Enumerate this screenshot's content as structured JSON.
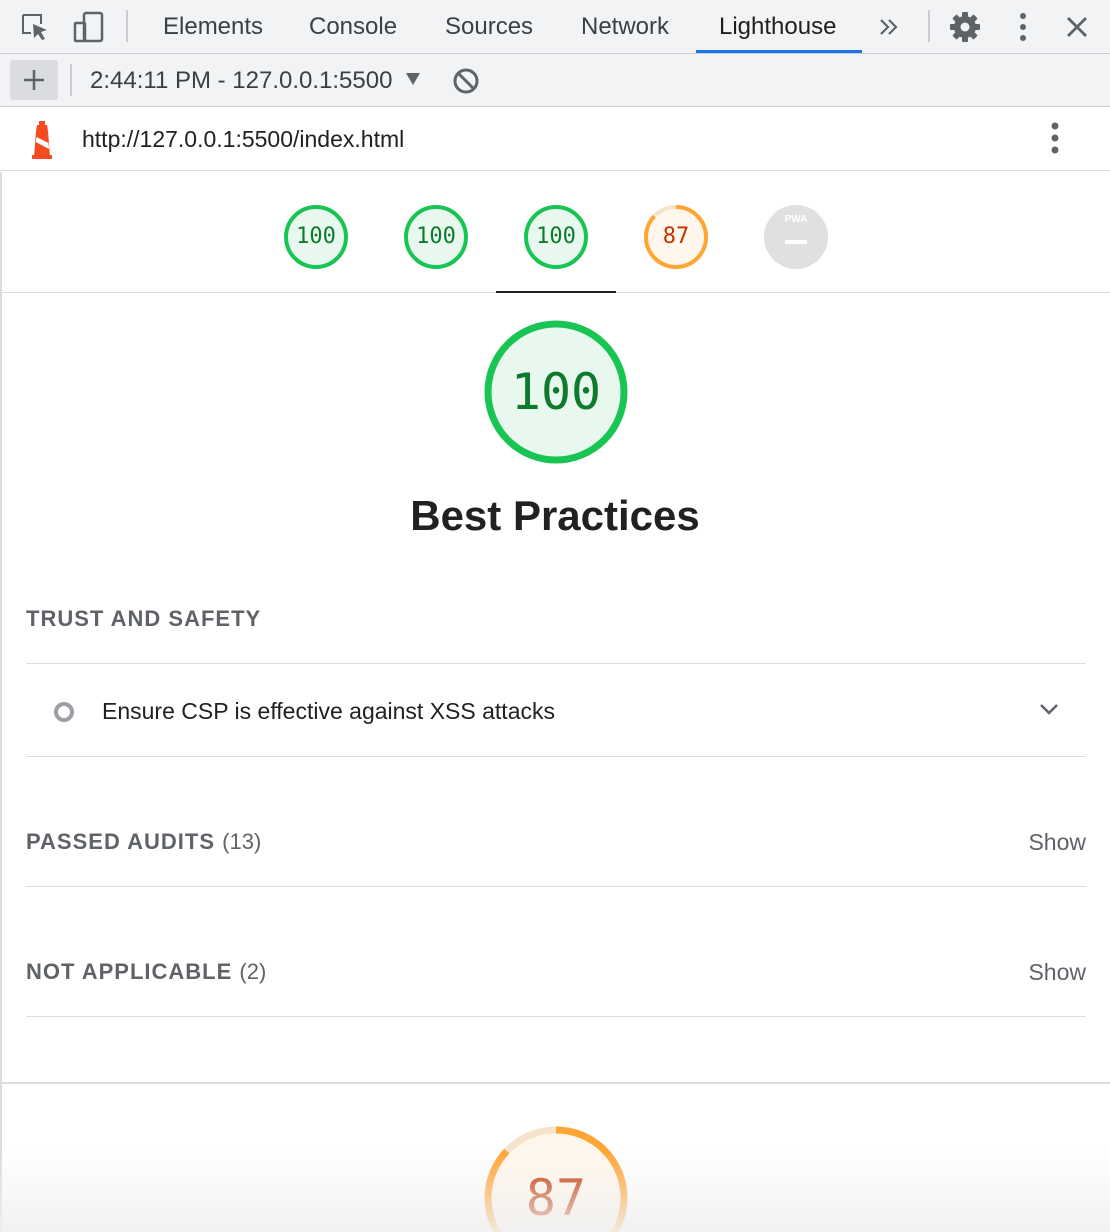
{
  "devtools": {
    "tabs": [
      "Elements",
      "Console",
      "Sources",
      "Network",
      "Lighthouse"
    ],
    "active_tab": "Lighthouse",
    "icons": [
      "inspect-element-icon",
      "device-toolbar-icon",
      "more-tabs-icon",
      "settings-gear-icon",
      "kebab-menu-icon",
      "close-icon"
    ]
  },
  "toolbar": {
    "new_report": "+",
    "report_select": "2:44:11 PM - 127.0.0.1:5500",
    "clear_icon": "clear-icon"
  },
  "report": {
    "url": "http://127.0.0.1:5500/index.html",
    "logo_icon": "lighthouse-logo-icon",
    "gauges": [
      {
        "score": "100",
        "status": "pass"
      },
      {
        "score": "100",
        "status": "pass"
      },
      {
        "score": "100",
        "status": "pass"
      },
      {
        "score": "87",
        "status": "average"
      },
      {
        "score": "",
        "status": "pwa",
        "badge": "PWA"
      }
    ],
    "selected_gauge_index": 2,
    "category": {
      "score": "100",
      "title": "Best Practices"
    },
    "groups": {
      "trust_title": "TRUST AND SAFETY",
      "audit_text": "Ensure CSP is effective against XSS attacks",
      "passed_title": "PASSED AUDITS",
      "passed_count": "(13)",
      "na_title": "NOT APPLICABLE",
      "na_count": "(2)",
      "show_label": "Show"
    },
    "next_category": {
      "score": "87"
    }
  },
  "colors": {
    "pass": "#18c452",
    "pass_fill": "#e8f8ee",
    "pass_text": "#0d7a2c",
    "average": "#ffa533",
    "average_fill": "#fff7ec",
    "average_text": "#c33300",
    "na": "#e0e0e0",
    "accent": "#1a73e8"
  }
}
